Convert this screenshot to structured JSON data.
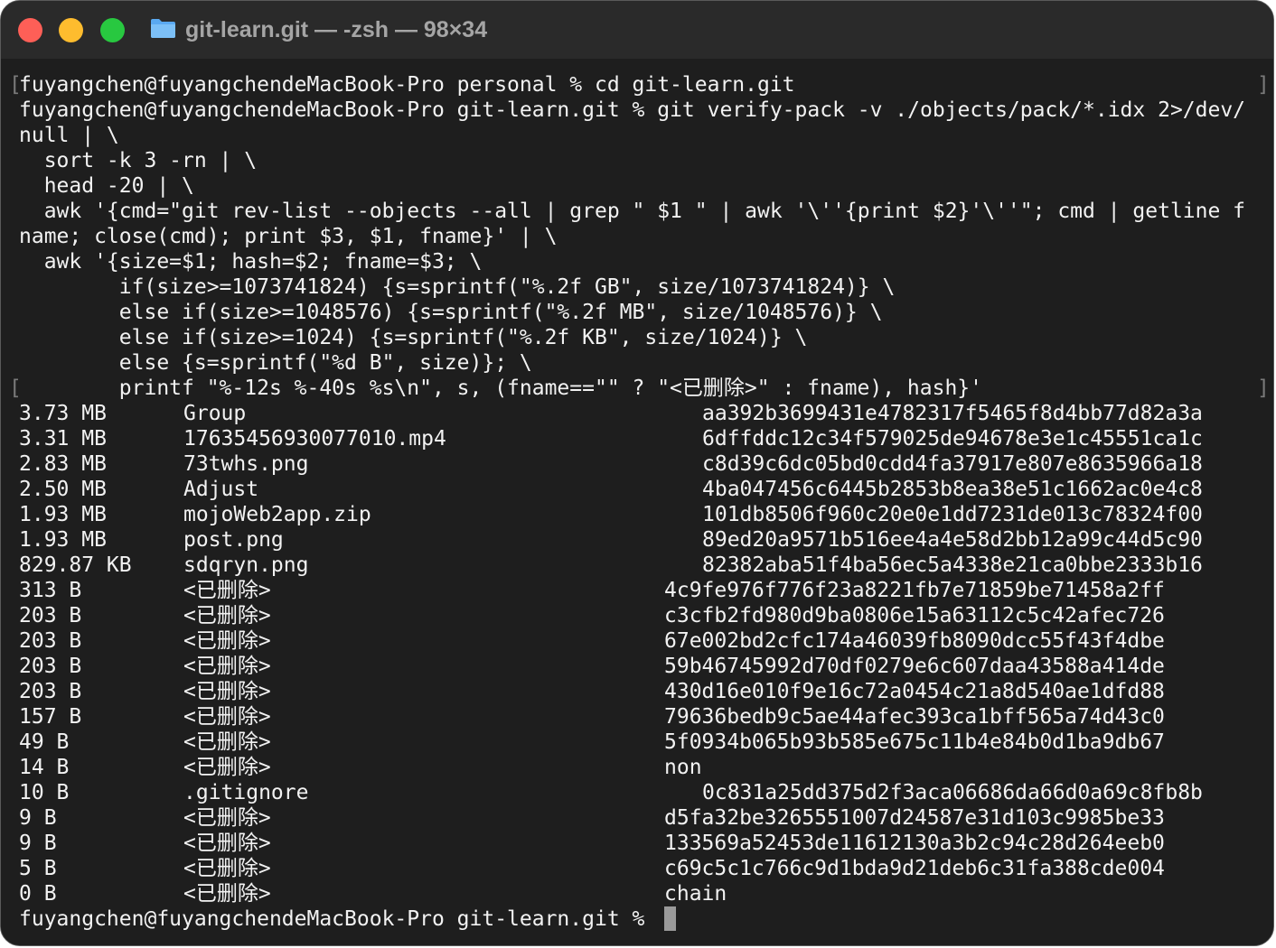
{
  "window": {
    "title": "git-learn.git — -zsh — 98×34",
    "colors": {
      "close": "#fe5f57",
      "minimize": "#febc2e",
      "zoom": "#28c840",
      "terminal_bg": "#1e1e1e",
      "text": "#f2f2f2"
    }
  },
  "terminal": {
    "command_lines": [
      "fuyangchen@fuyangchendeMacBook-Pro personal % cd git-learn.git",
      "fuyangchen@fuyangchendeMacBook-Pro git-learn.git % git verify-pack -v ./objects/pack/*.idx 2>/dev/",
      "null | \\",
      "  sort -k 3 -rn | \\",
      "  head -20 | \\",
      "  awk '{cmd=\"git rev-list --objects --all | grep \" $1 \" | awk '\\''{print $2}'\\''\"; cmd | getline f",
      "name; close(cmd); print $3, $1, fname}' | \\",
      "  awk '{size=$1; hash=$2; fname=$3; \\",
      "        if(size>=1073741824) {s=sprintf(\"%.2f GB\", size/1073741824)} \\",
      "        else if(size>=1048576) {s=sprintf(\"%.2f MB\", size/1048576)} \\",
      "        else if(size>=1024) {s=sprintf(\"%.2f KB\", size/1024)} \\",
      "        else {s=sprintf(\"%d B\", size)}; \\",
      "        printf \"%-12s %-40s %s\\n\", s, (fname==\"\" ? \"<已删除>\" : fname), hash}'"
    ],
    "results": [
      {
        "size": "3.73 MB",
        "name": "Group",
        "hash": "aa392b3699431e4782317f5465f8d4bb77d82a3a"
      },
      {
        "size": "3.31 MB",
        "name": "1763545693007701‌0.mp4",
        "hash": "6dffddc12c34f579025de94678e3e1c45551ca1c"
      },
      {
        "size": "2.83 MB",
        "name": "73twhs.png",
        "hash": "c8d39c6dc05bd0cdd4fa37917e807e8635966a18"
      },
      {
        "size": "2.50 MB",
        "name": "Adjust",
        "hash": "4ba047456c6445b2853b8ea38e51c1662ac0e4c8"
      },
      {
        "size": "1.93 MB",
        "name": "mojoWeb2app.zip",
        "hash": "101db8506f960c20e0e1dd7231de013c78324f00"
      },
      {
        "size": "1.93 MB",
        "name": "post.png",
        "hash": "89ed20a9571b516ee4a4e58d2bb12a99c44d5c90"
      },
      {
        "size": "829.87 KB",
        "name": "sdqryn.png",
        "hash": "82382aba51f4ba56ec5a4338e21ca0bbe2333b16"
      },
      {
        "size": "313 B",
        "name": "<已删除>",
        "hash": "4c9fe976f776f23a8221fb7e71859be71458a2ff"
      },
      {
        "size": "203 B",
        "name": "<已删除>",
        "hash": "c3cfb2fd980d9ba0806e15a63112c5c42afec726"
      },
      {
        "size": "203 B",
        "name": "<已删除>",
        "hash": "67e002bd2cfc174a46039fb8090dcc55f43f4dbe"
      },
      {
        "size": "203 B",
        "name": "<已删除>",
        "hash": "59b46745992d70df0279e6c607daa43588a414de"
      },
      {
        "size": "203 B",
        "name": "<已删除>",
        "hash": "430d16e010f9e16c72a0454c21a8d540ae1dfd88"
      },
      {
        "size": "157 B",
        "name": "<已删除>",
        "hash": "79636bedb9c5ae44afec393ca1bff565a74d43c0"
      },
      {
        "size": "49 B",
        "name": "<已删除>",
        "hash": "5f0934b065b93b585e675c11b4e84b0d1ba9db67"
      },
      {
        "size": "14 B",
        "name": "<已删除>",
        "hash": "non"
      },
      {
        "size": "10 B",
        "name": ".gitignore",
        "hash": "0c831a25dd375d2f3aca06686da66d0a69c8fb8b"
      },
      {
        "size": "9 B",
        "name": "<已删除>",
        "hash": "d5fa32be3265551007d24587e31d103c9985be33"
      },
      {
        "size": "9 B",
        "name": "<已删除>",
        "hash": "133569a52453de11612130a3b2c94c28d264eeb0"
      },
      {
        "size": "5 B",
        "name": "<已删除>",
        "hash": "c69c5c1c766c9d1bda9d21deb6c31fa388cde004"
      },
      {
        "size": "0 B",
        "name": "<已删除>",
        "hash": "chain"
      }
    ],
    "prompt": "fuyangchen@fuyangchendeMacBook-Pro git-learn.git %"
  }
}
